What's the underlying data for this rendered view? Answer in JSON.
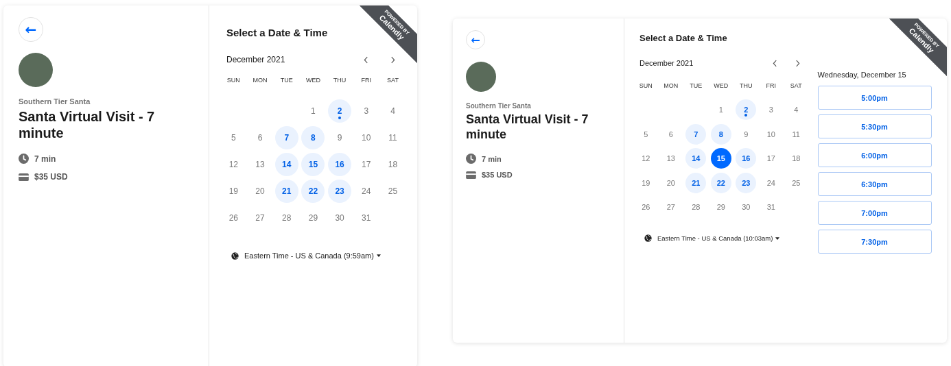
{
  "panels": [
    {
      "back_button": {
        "label": "←"
      },
      "organizer": "Southern Tier Santa",
      "event_title": "Santa Virtual Visit - 7 minute",
      "details": [
        {
          "kind": "duration",
          "text": "7 min"
        },
        {
          "kind": "price",
          "text": "$35 USD"
        }
      ],
      "ribbon": {
        "top": "POWERED BY",
        "brand": "Calendly"
      },
      "heading": "Select a Date & Time",
      "month": "December 2021",
      "weekdays": [
        "SUN",
        "MON",
        "TUE",
        "WED",
        "THU",
        "FRI",
        "SAT"
      ],
      "weeks": [
        [
          {
            "kind": "blank"
          },
          {
            "kind": "blank"
          },
          {
            "kind": "blank"
          },
          {
            "kind": "day",
            "label": "1",
            "available": false,
            "selected": false,
            "today": false
          },
          {
            "kind": "day",
            "label": "2",
            "available": true,
            "selected": false,
            "today": true
          },
          {
            "kind": "day",
            "label": "3",
            "available": false,
            "selected": false,
            "today": false
          },
          {
            "kind": "day",
            "label": "4",
            "available": false,
            "selected": false,
            "today": false
          }
        ],
        [
          {
            "kind": "day",
            "label": "5",
            "available": false,
            "selected": false,
            "today": false
          },
          {
            "kind": "day",
            "label": "6",
            "available": false,
            "selected": false,
            "today": false
          },
          {
            "kind": "day",
            "label": "7",
            "available": true,
            "selected": false,
            "today": false
          },
          {
            "kind": "day",
            "label": "8",
            "available": true,
            "selected": false,
            "today": false
          },
          {
            "kind": "day",
            "label": "9",
            "available": false,
            "selected": false,
            "today": false
          },
          {
            "kind": "day",
            "label": "10",
            "available": false,
            "selected": false,
            "today": false
          },
          {
            "kind": "day",
            "label": "11",
            "available": false,
            "selected": false,
            "today": false
          }
        ],
        [
          {
            "kind": "day",
            "label": "12",
            "available": false,
            "selected": false,
            "today": false
          },
          {
            "kind": "day",
            "label": "13",
            "available": false,
            "selected": false,
            "today": false
          },
          {
            "kind": "day",
            "label": "14",
            "available": true,
            "selected": false,
            "today": false
          },
          {
            "kind": "day",
            "label": "15",
            "available": true,
            "selected": false,
            "today": false
          },
          {
            "kind": "day",
            "label": "16",
            "available": true,
            "selected": false,
            "today": false
          },
          {
            "kind": "day",
            "label": "17",
            "available": false,
            "selected": false,
            "today": false
          },
          {
            "kind": "day",
            "label": "18",
            "available": false,
            "selected": false,
            "today": false
          }
        ],
        [
          {
            "kind": "day",
            "label": "19",
            "available": false,
            "selected": false,
            "today": false
          },
          {
            "kind": "day",
            "label": "20",
            "available": false,
            "selected": false,
            "today": false
          },
          {
            "kind": "day",
            "label": "21",
            "available": true,
            "selected": false,
            "today": false
          },
          {
            "kind": "day",
            "label": "22",
            "available": true,
            "selected": false,
            "today": false
          },
          {
            "kind": "day",
            "label": "23",
            "available": true,
            "selected": false,
            "today": false
          },
          {
            "kind": "day",
            "label": "24",
            "available": false,
            "selected": false,
            "today": false
          },
          {
            "kind": "day",
            "label": "25",
            "available": false,
            "selected": false,
            "today": false
          }
        ],
        [
          {
            "kind": "day",
            "label": "26",
            "available": false,
            "selected": false,
            "today": false
          },
          {
            "kind": "day",
            "label": "27",
            "available": false,
            "selected": false,
            "today": false
          },
          {
            "kind": "day",
            "label": "28",
            "available": false,
            "selected": false,
            "today": false
          },
          {
            "kind": "day",
            "label": "29",
            "available": false,
            "selected": false,
            "today": false
          },
          {
            "kind": "day",
            "label": "30",
            "available": false,
            "selected": false,
            "today": false
          },
          {
            "kind": "day",
            "label": "31",
            "available": false,
            "selected": false,
            "today": false
          },
          {
            "kind": "blank"
          }
        ]
      ],
      "timezone": "Eastern Time - US & Canada (9:59am)"
    },
    {
      "back_button": {
        "label": "←"
      },
      "organizer": "Southern Tier Santa",
      "event_title": "Santa Virtual Visit - 7 minute",
      "details": [
        {
          "kind": "duration",
          "text": "7 min"
        },
        {
          "kind": "price",
          "text": "$35 USD"
        }
      ],
      "ribbon": {
        "top": "POWERED BY",
        "brand": "Calendly"
      },
      "heading": "Select a Date & Time",
      "month": "December 2021",
      "weekdays": [
        "SUN",
        "MON",
        "TUE",
        "WED",
        "THU",
        "FRI",
        "SAT"
      ],
      "weeks": [
        [
          {
            "kind": "blank"
          },
          {
            "kind": "blank"
          },
          {
            "kind": "blank"
          },
          {
            "kind": "day",
            "label": "1",
            "available": false,
            "selected": false,
            "today": false
          },
          {
            "kind": "day",
            "label": "2",
            "available": true,
            "selected": false,
            "today": true
          },
          {
            "kind": "day",
            "label": "3",
            "available": false,
            "selected": false,
            "today": false
          },
          {
            "kind": "day",
            "label": "4",
            "available": false,
            "selected": false,
            "today": false
          }
        ],
        [
          {
            "kind": "day",
            "label": "5",
            "available": false,
            "selected": false,
            "today": false
          },
          {
            "kind": "day",
            "label": "6",
            "available": false,
            "selected": false,
            "today": false
          },
          {
            "kind": "day",
            "label": "7",
            "available": true,
            "selected": false,
            "today": false
          },
          {
            "kind": "day",
            "label": "8",
            "available": true,
            "selected": false,
            "today": false
          },
          {
            "kind": "day",
            "label": "9",
            "available": false,
            "selected": false,
            "today": false
          },
          {
            "kind": "day",
            "label": "10",
            "available": false,
            "selected": false,
            "today": false
          },
          {
            "kind": "day",
            "label": "11",
            "available": false,
            "selected": false,
            "today": false
          }
        ],
        [
          {
            "kind": "day",
            "label": "12",
            "available": false,
            "selected": false,
            "today": false
          },
          {
            "kind": "day",
            "label": "13",
            "available": false,
            "selected": false,
            "today": false
          },
          {
            "kind": "day",
            "label": "14",
            "available": true,
            "selected": false,
            "today": false
          },
          {
            "kind": "day",
            "label": "15",
            "available": true,
            "selected": true,
            "today": false
          },
          {
            "kind": "day",
            "label": "16",
            "available": true,
            "selected": false,
            "today": false
          },
          {
            "kind": "day",
            "label": "17",
            "available": false,
            "selected": false,
            "today": false
          },
          {
            "kind": "day",
            "label": "18",
            "available": false,
            "selected": false,
            "today": false
          }
        ],
        [
          {
            "kind": "day",
            "label": "19",
            "available": false,
            "selected": false,
            "today": false
          },
          {
            "kind": "day",
            "label": "20",
            "available": false,
            "selected": false,
            "today": false
          },
          {
            "kind": "day",
            "label": "21",
            "available": true,
            "selected": false,
            "today": false
          },
          {
            "kind": "day",
            "label": "22",
            "available": true,
            "selected": false,
            "today": false
          },
          {
            "kind": "day",
            "label": "23",
            "available": true,
            "selected": false,
            "today": false
          },
          {
            "kind": "day",
            "label": "24",
            "available": false,
            "selected": false,
            "today": false
          },
          {
            "kind": "day",
            "label": "25",
            "available": false,
            "selected": false,
            "today": false
          }
        ],
        [
          {
            "kind": "day",
            "label": "26",
            "available": false,
            "selected": false,
            "today": false
          },
          {
            "kind": "day",
            "label": "27",
            "available": false,
            "selected": false,
            "today": false
          },
          {
            "kind": "day",
            "label": "28",
            "available": false,
            "selected": false,
            "today": false
          },
          {
            "kind": "day",
            "label": "29",
            "available": false,
            "selected": false,
            "today": false
          },
          {
            "kind": "day",
            "label": "30",
            "available": false,
            "selected": false,
            "today": false
          },
          {
            "kind": "day",
            "label": "31",
            "available": false,
            "selected": false,
            "today": false
          },
          {
            "kind": "blank"
          }
        ]
      ],
      "timezone": "Eastern Time - US & Canada (10:03am)",
      "selected_date": "Wednesday, December 15",
      "time_slots": [
        "5:00pm",
        "5:30pm",
        "6:00pm",
        "6:30pm",
        "7:00pm",
        "7:30pm"
      ]
    }
  ]
}
